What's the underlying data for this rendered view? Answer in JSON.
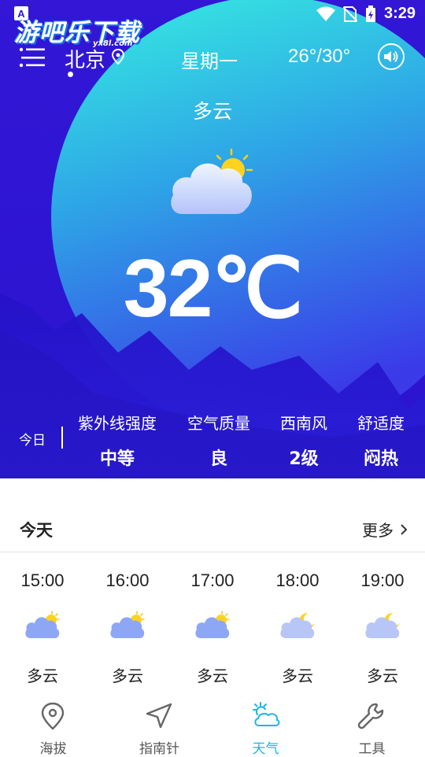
{
  "status_bar": {
    "time": "3:29"
  },
  "watermark": {
    "text": "游吧乐下载",
    "sub": "yx8l.com"
  },
  "header": {
    "city": "北京",
    "weekday": "星期一",
    "temp_range": "26°/30°"
  },
  "current": {
    "condition": "多云",
    "temperature": "32℃"
  },
  "today_stats": {
    "label": "今日",
    "items": [
      {
        "label": "紫外线强度",
        "value": "中等"
      },
      {
        "label": "空气质量",
        "value": "良"
      },
      {
        "label": "西南风",
        "value": "2级"
      },
      {
        "label": "舒适度",
        "value": "闷热"
      }
    ]
  },
  "hourly": {
    "title": "今天",
    "more": "更多",
    "items": [
      {
        "time": "15:00",
        "condition": "多云",
        "icon": "cloud-sun-icon"
      },
      {
        "time": "16:00",
        "condition": "多云",
        "icon": "cloud-sun-icon"
      },
      {
        "time": "17:00",
        "condition": "多云",
        "icon": "cloud-sun-icon"
      },
      {
        "time": "18:00",
        "condition": "多云",
        "icon": "cloud-moon-icon"
      },
      {
        "time": "19:00",
        "condition": "多云",
        "icon": "cloud-moon-icon"
      }
    ]
  },
  "tabbar": {
    "items": [
      {
        "label": "海拔",
        "icon": "location-pin-icon"
      },
      {
        "label": "指南针",
        "icon": "navigation-arrow-icon"
      },
      {
        "label": "天气",
        "icon": "weather-icon",
        "active": true
      },
      {
        "label": "工具",
        "icon": "wrench-icon"
      }
    ]
  },
  "colors": {
    "hero_top": "#2f18d8",
    "circle_top": "#35eadf",
    "circle_bottom": "#3d3be8",
    "mountain": "#2418c8",
    "accent": "#1eb3e6"
  }
}
